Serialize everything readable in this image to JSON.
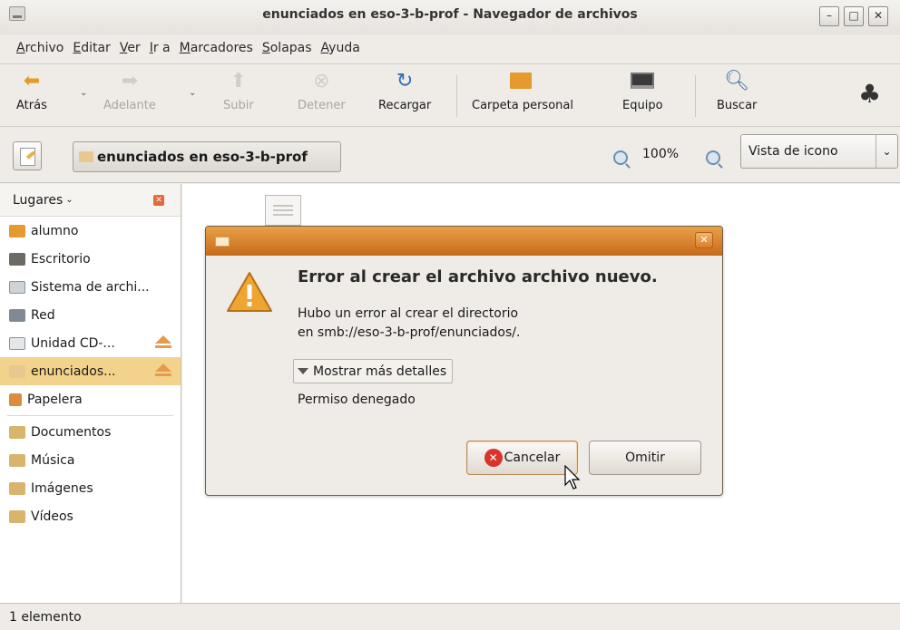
{
  "window": {
    "title": "enunciados en eso-3-b-prof - Navegador de archivos"
  },
  "menu": [
    "Archivo",
    "Editar",
    "Ver",
    "Ir a",
    "Marcadores",
    "Solapas",
    "Ayuda"
  ],
  "toolbar": {
    "back": "Atrás",
    "forward": "Adelante",
    "up": "Subir",
    "stop": "Detener",
    "reload": "Recargar",
    "home": "Carpeta personal",
    "computer": "Equipo",
    "search": "Buscar"
  },
  "location": {
    "path": "enunciados en eso-3-b-prof",
    "zoom": "100%",
    "view": "Vista de icono"
  },
  "sidebar": {
    "header": "Lugares",
    "items": [
      {
        "label": "alumno"
      },
      {
        "label": "Escritorio"
      },
      {
        "label": "Sistema de archi..."
      },
      {
        "label": "Red"
      },
      {
        "label": "Unidad CD-..."
      },
      {
        "label": "enunciados..."
      },
      {
        "label": "Papelera"
      },
      {
        "label": "Documentos"
      },
      {
        "label": "Música"
      },
      {
        "label": "Imágenes"
      },
      {
        "label": "Vídeos"
      }
    ]
  },
  "status": {
    "text": "1 elemento"
  },
  "dialog": {
    "heading": "Error al crear el archivo archivo nuevo.",
    "body_line1": "Hubo un error al crear el directorio",
    "body_line2": "en smb://eso-3-b-prof/enunciados/.",
    "details": "Mostrar más detalles",
    "permission": "Permiso denegado",
    "cancel": "Cancelar",
    "skip": "Omitir"
  },
  "colors": {
    "accent": "#d9822b",
    "selection": "#f3d38b",
    "error": "#d8342b"
  }
}
